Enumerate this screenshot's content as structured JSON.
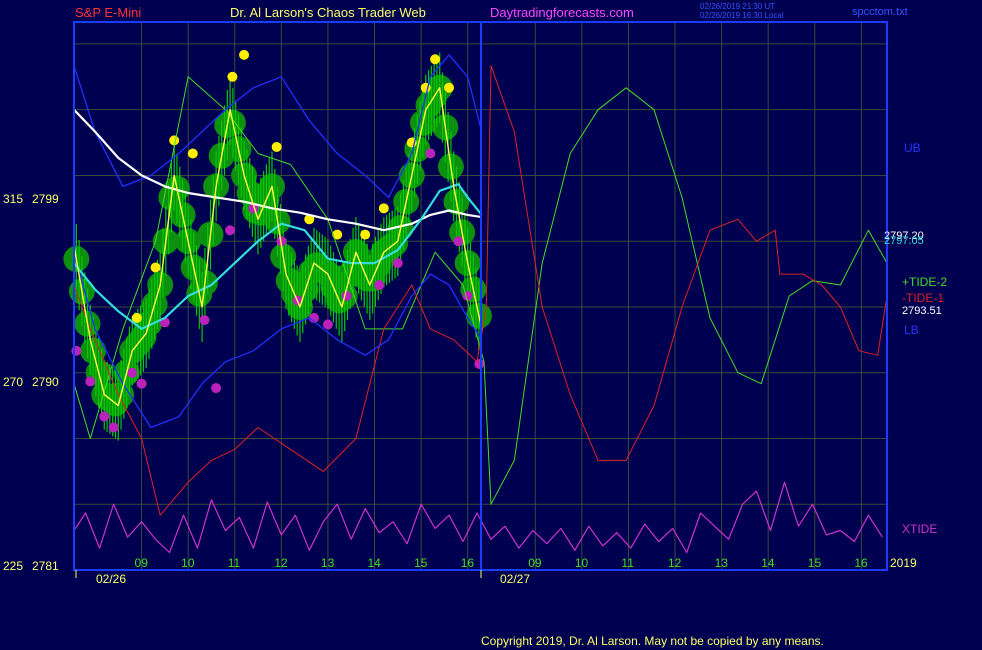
{
  "header": {
    "symbol": "S&P E-Mini",
    "author": "Dr. Al Larson's Chaos Trader Web",
    "site": "Daytradingforecasts.com",
    "stamp_line1": "02/26/2019 21:30 UT",
    "stamp_line2": "02/26/2019 16:30 Local",
    "file": "spcctom.txt"
  },
  "footer": {
    "copyright": "Copyright 2019, Dr. Al Larson. May not be copied by any means."
  },
  "colors": {
    "background": "#000050",
    "frame": "#1a3cff",
    "grid": "#3a4a3a",
    "ub_lb": "#2030ff",
    "tide_plus": "#44dd22",
    "tide_minus": "#dd2222",
    "xtide": "#cc33cc",
    "price": "#ffff44",
    "white_avg": "#ffffff",
    "cyan_avg": "#33dddd",
    "green_tick": "#00cc00",
    "halo": "#0f8f0f",
    "yellow_dot": "#ffee00",
    "magenta_dot": "#bb22bb"
  },
  "chart_data": {
    "type": "line",
    "title": "S&P E-Mini",
    "x_tick_labels": [
      "09",
      "10",
      "11",
      "12",
      "13",
      "14",
      "15",
      "16",
      "09",
      "10",
      "11",
      "12",
      "13",
      "14",
      "15",
      "16"
    ],
    "date_labels": [
      "02/26",
      "02/27"
    ],
    "year_label": "2019",
    "y_left_labels": [
      {
        "osc": "315",
        "price": "2799"
      },
      {
        "osc": "270",
        "price": "2790"
      },
      {
        "osc": "225",
        "price": "2781"
      }
    ],
    "right_labels": {
      "ub": "UB",
      "price_a": "2797.20",
      "price_b": "2797.05",
      "tide_plus": "+TIDE-2",
      "tide_minus": "-TIDE-1",
      "last_price": "2793.51",
      "lb": "LB",
      "xtide": "XTIDE"
    },
    "ylim": [
      2781,
      2806
    ],
    "grid": true,
    "series": [
      {
        "name": "+TIDE-2",
        "x": [
          7.55,
          7.9,
          8.6,
          9.3,
          10.0,
          10.8,
          11.5,
          12.2,
          13.0,
          13.8,
          14.6,
          15.3,
          15.9,
          16.35,
          16.5,
          17.0,
          17.6,
          18.2,
          18.8,
          19.4,
          20.0,
          20.6,
          21.2,
          21.8,
          22.3,
          22.9,
          23.4,
          24.0,
          24.6,
          25.0
        ],
        "y": [
          2789.5,
          2787.0,
          2792.0,
          2796.0,
          2803.5,
          2802.0,
          2800.0,
          2799.5,
          2797.0,
          2792.0,
          2792.0,
          2795.5,
          2794.0,
          2790.5,
          2784.0,
          2786.0,
          2795.0,
          2800.0,
          2802.0,
          2803.0,
          2802.0,
          2798.0,
          2792.5,
          2790.0,
          2789.5,
          2793.5,
          2794.2,
          2794.0,
          2796.5,
          2795.0
        ]
      },
      {
        "name": "-TIDE-1",
        "x": [
          7.55,
          7.9,
          8.5,
          9.0,
          9.4,
          10.0,
          10.5,
          11.0,
          11.5,
          12.2,
          12.9,
          13.6,
          14.2,
          14.8,
          15.2,
          15.7,
          16.2,
          16.4,
          16.5,
          17.0,
          17.6,
          18.2,
          18.8,
          19.4,
          20.0,
          20.6,
          21.2,
          21.8,
          22.2,
          22.6,
          22.7,
          23.2,
          23.6,
          24.0,
          24.4,
          24.8,
          25.0
        ],
        "y": [
          2794.0,
          2792.0,
          2789.0,
          2787.0,
          2783.5,
          2785.0,
          2786.0,
          2786.5,
          2787.5,
          2786.5,
          2785.5,
          2787.0,
          2792.0,
          2794.0,
          2792.0,
          2791.5,
          2790.5,
          2793.0,
          2804.0,
          2801.0,
          2793.0,
          2789.0,
          2786.0,
          2786.0,
          2788.5,
          2793.0,
          2796.5,
          2797.0,
          2796.0,
          2796.5,
          2794.5,
          2794.5,
          2794.0,
          2793.0,
          2791.0,
          2790.8,
          2793.5
        ]
      },
      {
        "name": "XTIDE",
        "x": [
          7.55,
          7.8,
          8.1,
          8.4,
          8.7,
          9.0,
          9.3,
          9.6,
          9.9,
          10.2,
          10.5,
          10.8,
          11.1,
          11.4,
          11.7,
          12.0,
          12.3,
          12.6,
          12.9,
          13.2,
          13.5,
          13.8,
          14.1,
          14.4,
          14.7,
          15.0,
          15.3,
          15.6,
          15.9,
          16.2,
          16.5,
          16.8,
          17.1,
          17.4,
          17.7,
          18.0,
          18.3,
          18.6,
          18.9,
          19.2,
          19.5,
          19.8,
          20.1,
          20.4,
          20.7,
          21.0,
          21.3,
          21.6,
          21.9,
          22.2,
          22.5,
          22.8,
          23.1,
          23.4,
          23.7,
          24.0,
          24.3,
          24.6,
          24.9
        ],
        "y": [
          2782.8,
          2783.6,
          2782.0,
          2784.0,
          2782.5,
          2783.2,
          2782.4,
          2781.8,
          2783.5,
          2782.0,
          2784.2,
          2782.8,
          2783.4,
          2782.0,
          2784.1,
          2782.6,
          2783.5,
          2781.9,
          2783.2,
          2784.0,
          2782.4,
          2783.8,
          2782.7,
          2783.2,
          2782.2,
          2784.0,
          2782.9,
          2783.5,
          2782.3,
          2783.6,
          2782.4,
          2783.0,
          2782.0,
          2782.8,
          2782.2,
          2782.9,
          2781.9,
          2783.0,
          2782.1,
          2782.7,
          2782.0,
          2783.1,
          2782.3,
          2782.9,
          2781.8,
          2783.6,
          2783.0,
          2782.4,
          2784.0,
          2784.6,
          2782.8,
          2785.0,
          2783.0,
          2784.0,
          2782.6,
          2782.8,
          2782.3,
          2783.5,
          2782.5
        ]
      },
      {
        "name": "UB",
        "x": [
          7.55,
          8.0,
          8.6,
          9.2,
          9.8,
          10.3,
          10.8,
          11.4,
          12.0,
          12.6,
          13.2,
          13.8,
          14.3,
          14.8,
          15.2,
          15.6,
          16.0,
          16.3
        ],
        "y": [
          2804.0,
          2801.0,
          2798.5,
          2799.0,
          2800.0,
          2801.0,
          2802.0,
          2803.0,
          2803.5,
          2801.5,
          2800.0,
          2799.0,
          2798.0,
          2800.0,
          2803.5,
          2804.5,
          2803.5,
          2801.0
        ]
      },
      {
        "name": "LB",
        "x": [
          7.55,
          8.0,
          8.6,
          9.2,
          9.8,
          10.3,
          10.8,
          11.4,
          12.0,
          12.6,
          13.2,
          13.8,
          14.3,
          14.8,
          15.2,
          15.6,
          16.0,
          16.3
        ],
        "y": [
          2795.5,
          2792.0,
          2789.5,
          2787.5,
          2788.0,
          2789.5,
          2790.5,
          2791.0,
          2792.0,
          2792.5,
          2791.5,
          2790.8,
          2791.5,
          2793.5,
          2794.5,
          2794.0,
          2792.5,
          2791.5
        ]
      },
      {
        "name": "",
        "x": [
          7.55,
          8.0,
          8.5,
          9.0,
          9.5,
          10.0,
          10.6,
          11.2,
          11.8,
          12.4,
          13.0,
          13.6,
          14.2,
          14.8,
          15.2,
          15.6,
          16.0,
          16.3
        ],
        "y": [
          2802.0,
          2801.0,
          2799.8,
          2799.0,
          2798.5,
          2798.2,
          2798.0,
          2797.8,
          2797.5,
          2797.3,
          2797.0,
          2796.8,
          2796.5,
          2796.8,
          2797.2,
          2797.4,
          2797.2,
          2797.1
        ]
      },
      {
        "name": "",
        "x": [
          7.55,
          8.0,
          8.5,
          9.0,
          9.5,
          10.0,
          10.5,
          11.0,
          11.5,
          12.0,
          12.5,
          13.0,
          13.5,
          14.0,
          14.5,
          15.0,
          15.4,
          15.8,
          16.0,
          16.3
        ],
        "y": [
          2795.0,
          2793.8,
          2792.8,
          2792.0,
          2792.5,
          2793.5,
          2794.0,
          2795.0,
          2796.0,
          2796.8,
          2796.5,
          2795.2,
          2795.0,
          2795.0,
          2795.6,
          2797.0,
          2798.3,
          2798.6,
          2798.0,
          2797.2
        ]
      },
      {
        "name": "",
        "x": [
          7.55,
          7.9,
          8.2,
          8.5,
          8.8,
          9.1,
          9.4,
          9.7,
          10.0,
          10.3,
          10.6,
          10.9,
          11.2,
          11.5,
          11.8,
          12.1,
          12.4,
          12.7,
          13.0,
          13.3,
          13.6,
          13.9,
          14.2,
          14.5,
          14.8,
          15.1,
          15.4,
          15.7,
          16.0,
          16.3
        ],
        "y": [
          2795.8,
          2791.5,
          2789.0,
          2788.5,
          2791.0,
          2791.8,
          2794.0,
          2799.0,
          2796.0,
          2793.0,
          2798.5,
          2802.0,
          2799.0,
          2797.0,
          2798.5,
          2794.5,
          2793.0,
          2795.0,
          2794.5,
          2793.0,
          2795.5,
          2794.0,
          2795.5,
          2796.0,
          2799.0,
          2802.0,
          2803.0,
          2798.5,
          2795.0,
          2792.0
        ]
      }
    ]
  }
}
